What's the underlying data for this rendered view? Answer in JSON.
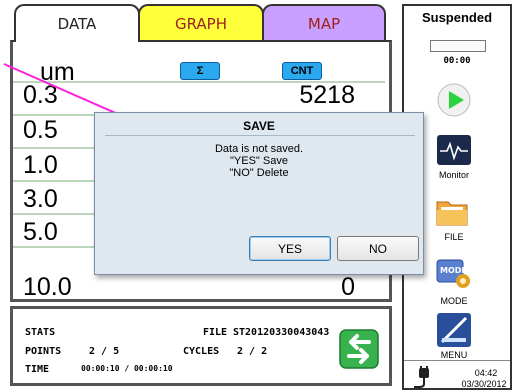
{
  "tabs": [
    {
      "label": "DATA"
    },
    {
      "label": "GRAPH"
    },
    {
      "label": "MAP"
    }
  ],
  "table": {
    "header_label": "um",
    "sum_button": "Σ",
    "cnt_button": "CNT",
    "rows": [
      {
        "size": "0.3",
        "value": "5218"
      },
      {
        "size": "0.5",
        "value": ""
      },
      {
        "size": "1.0",
        "value": ""
      },
      {
        "size": "3.0",
        "value": ""
      },
      {
        "size": "5.0",
        "value": ""
      },
      {
        "size": "10.0",
        "value": "0"
      }
    ]
  },
  "stats": {
    "stats_label": "STATS",
    "file_label": "FILE",
    "file_value": "ST20120330043043",
    "points_label": "POINTS",
    "points_value": "2 / 5",
    "cycles_label": "CYCLES",
    "cycles_value": "2 / 2",
    "time_label": "TIME",
    "time_value": "00:00:10 / 00:00:10"
  },
  "sidebar": {
    "status": "Suspended",
    "timer": "00:00",
    "monitor_label": "Monitor",
    "file_label": "FILE",
    "mode_label": "MODE",
    "menu_label": "MENU",
    "clock_time": "04:42",
    "clock_date": "03/30/2012"
  },
  "dialog": {
    "title": "SAVE",
    "line1": "Data is not saved.",
    "line2": "\"YES\" Save",
    "line3": "\"NO\"  Delete",
    "yes_label": "YES",
    "no_label": "NO"
  },
  "colors": {
    "accent_blue": "#2aa9ef",
    "tab_graph": "#ffff3a",
    "tab_map": "#c9a0ff",
    "arrow_pink": "#ff22dd"
  }
}
